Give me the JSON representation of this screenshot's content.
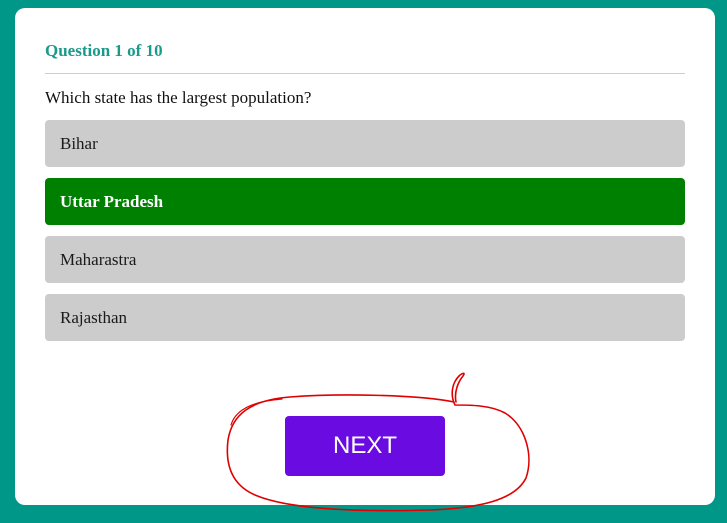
{
  "quiz": {
    "header": "Question 1 of 10",
    "question": "Which state has the largest population?",
    "options": [
      {
        "label": "Bihar",
        "state": "neutral"
      },
      {
        "label": "Uttar Pradesh",
        "state": "correct"
      },
      {
        "label": "Maharastra",
        "state": "neutral"
      },
      {
        "label": "Rajasthan",
        "state": "neutral"
      }
    ],
    "next_label": "NEXT"
  },
  "colors": {
    "page_background": "#009688",
    "header_text": "#1a9a8a",
    "option_neutral": "#cccccc",
    "option_correct": "#008000",
    "next_button": "#6a0be2",
    "annotation_stroke": "#e00000"
  }
}
